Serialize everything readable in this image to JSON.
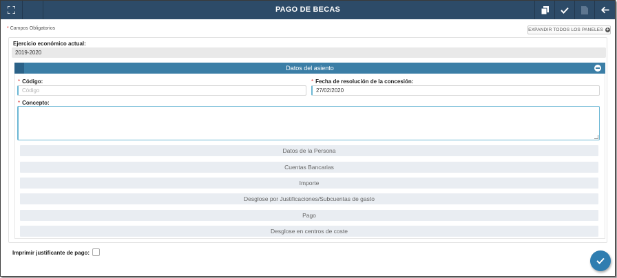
{
  "window": {
    "title": "PAGO DE BECAS"
  },
  "toolbar": {
    "fullscreen_icon": "fullscreen-icon",
    "copy_icon": "copy-icon",
    "confirm_icon": "check-icon",
    "document_icon": "document-icon",
    "back_icon": "arrow-left-icon"
  },
  "form": {
    "required_note": "Campos Obligatorios",
    "expand_all_label": "EXPANDIR TODOS LOS PANELES",
    "ejercicio_label": "Ejercicio económico actual:",
    "ejercicio_value": "2019-2020",
    "section_title": "Datos del asiento",
    "codigo_label": "Código:",
    "codigo_placeholder": "Código",
    "fecha_label": "Fecha de resolución de la concesión:",
    "fecha_value": "27/02/2020",
    "concepto_label": "Concepto:",
    "subpanels": [
      "Datos de la Persona",
      "Cuentas Bancarias",
      "Importe",
      "Desglose por Justificaciones/Subcuentas de gasto",
      "Pago",
      "Desglose en centros de coste"
    ],
    "print_label": "Imprimir justificante de pago:",
    "print_checked": false
  },
  "colors": {
    "topbar": "#2d4b68",
    "section": "#3b7ea6",
    "fab": "#2f7db0",
    "required": "#d9302c"
  }
}
